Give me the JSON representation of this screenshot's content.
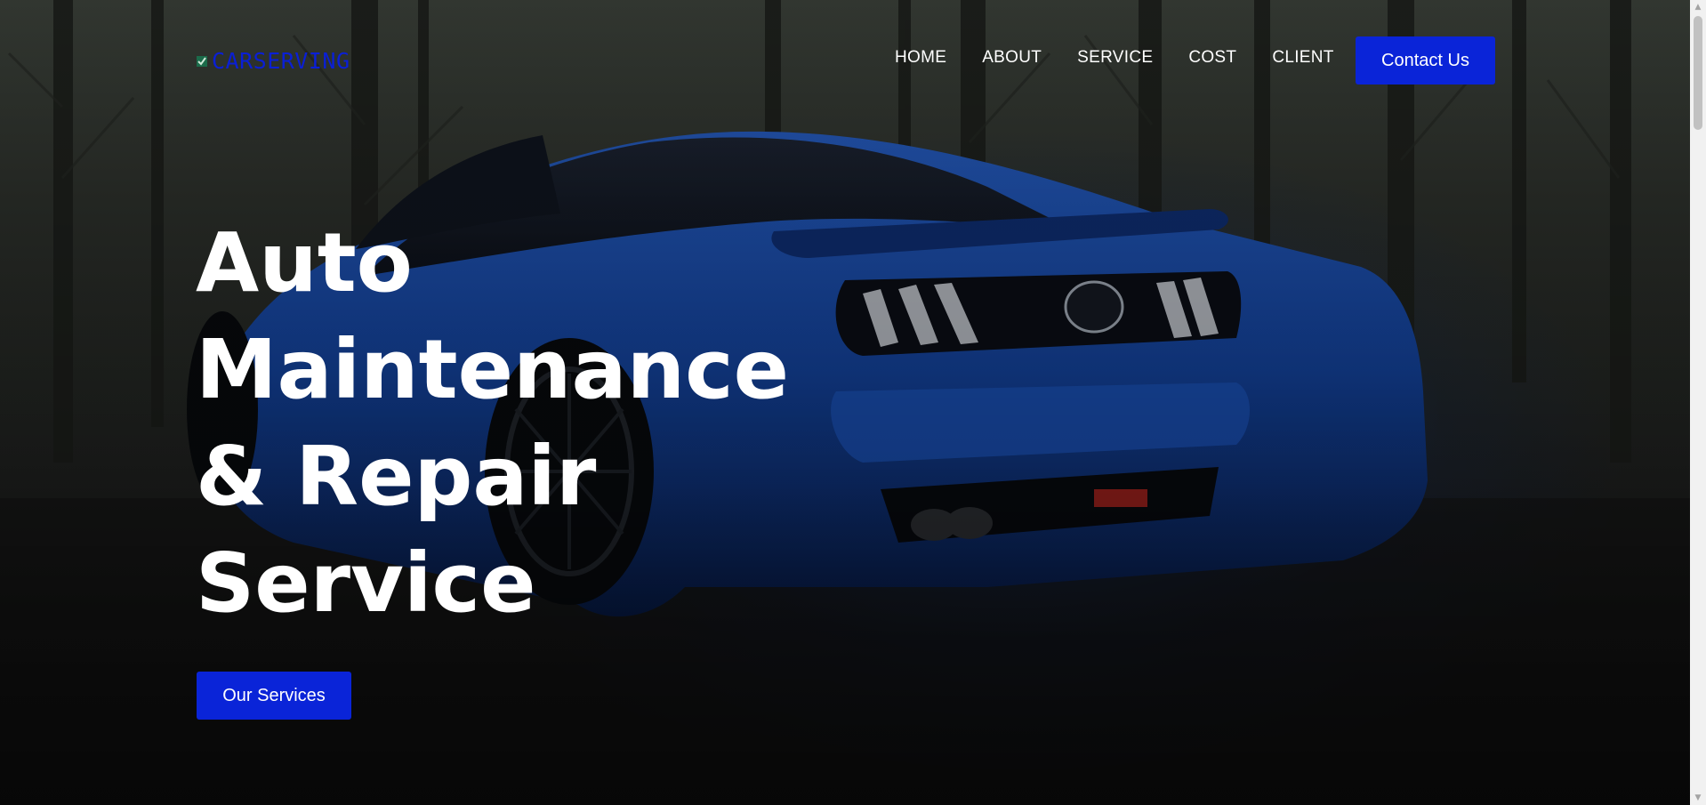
{
  "brand": {
    "name": "CARSERVING",
    "icon": "logo-check-icon",
    "color": "#0a1fd6"
  },
  "nav": {
    "items": [
      {
        "label": "HOME"
      },
      {
        "label": "ABOUT"
      },
      {
        "label": "SERVICE"
      },
      {
        "label": "COST"
      },
      {
        "label": "CLIENT"
      }
    ],
    "contact_label": "Contact Us"
  },
  "hero": {
    "headline_lines": [
      "Auto",
      "Maintenance",
      "& Repair",
      "Service"
    ],
    "cta_label": "Our Services",
    "background": "blue sports car in a forest"
  },
  "colors": {
    "accent": "#0a24d8",
    "text": "#ffffff"
  }
}
